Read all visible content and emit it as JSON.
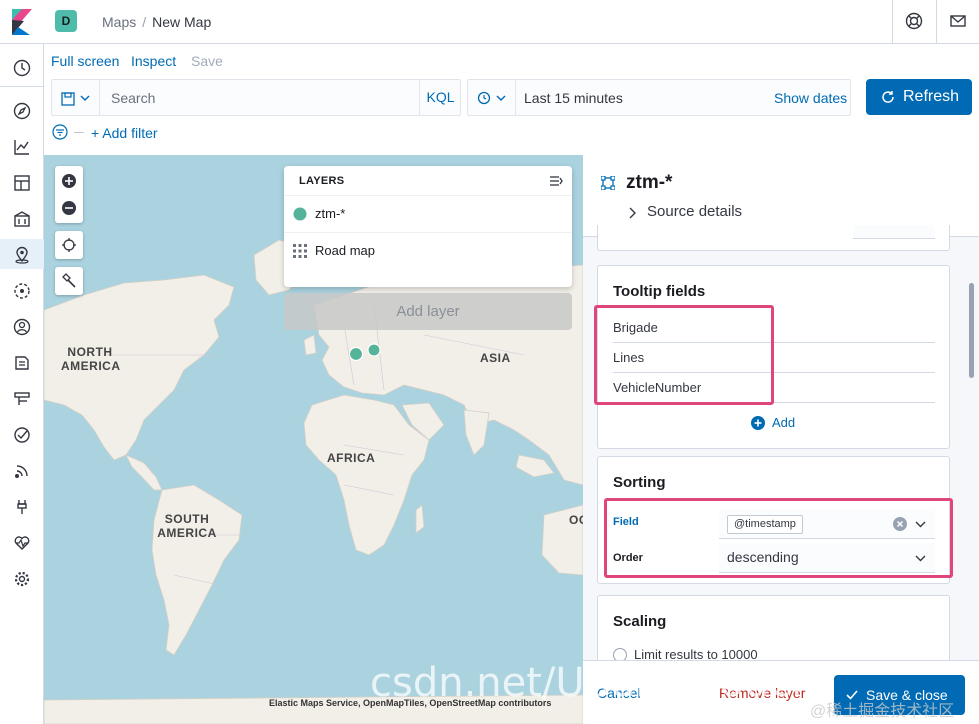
{
  "header": {
    "space_initial": "D",
    "breadcrumbs": [
      "Maps",
      "New Map"
    ]
  },
  "toolbar": {
    "full_screen": "Full screen",
    "inspect": "Inspect",
    "save": "Save"
  },
  "query": {
    "search_placeholder": "Search",
    "language": "KQL"
  },
  "date": {
    "range_label": "Last 15 minutes",
    "show_dates": "Show dates"
  },
  "refresh_label": "Refresh",
  "filters": {
    "add_filter": "+ Add filter"
  },
  "map": {
    "labels": [
      "NORTH\nAMERICA",
      "ASIA",
      "AFRICA",
      "SOUTH\nAMERICA",
      "OC"
    ],
    "attribution": "Elastic Maps Service, OpenMapTiles, OpenStreetMap contributors",
    "colors": {
      "water": "#aad3df",
      "land": "#f2efe9",
      "point": "#54b399"
    }
  },
  "layers_panel": {
    "title": "LAYERS",
    "layers": [
      {
        "name": "ztm-*",
        "icon": "circle-icon",
        "color": "#54b399"
      },
      {
        "name": "Road map",
        "icon": "grid-icon"
      }
    ],
    "add_layer": "Add layer"
  },
  "layer_editor": {
    "title": "ztm-*",
    "source_details": "Source details",
    "tooltip": {
      "heading": "Tooltip fields",
      "fields": [
        "Brigade",
        "Lines",
        "VehicleNumber"
      ],
      "add_label": "Add"
    },
    "sorting": {
      "heading": "Sorting",
      "field_label": "Field",
      "field_value": "@timestamp",
      "order_label": "Order",
      "order_value": "descending"
    },
    "scaling": {
      "heading": "Scaling",
      "limit_label": "Limit results to 10000"
    }
  },
  "footer": {
    "cancel": "Cancel",
    "remove_layer": "Remove layer",
    "save_close": "Save & close"
  },
  "watermark": "csdn.net/UbuntuTouch",
  "watermark2": "@稀土掘金技术社区",
  "colors": {
    "accent": "#006bb4",
    "highlight": "#e0457b",
    "danger": "#bd271e"
  }
}
